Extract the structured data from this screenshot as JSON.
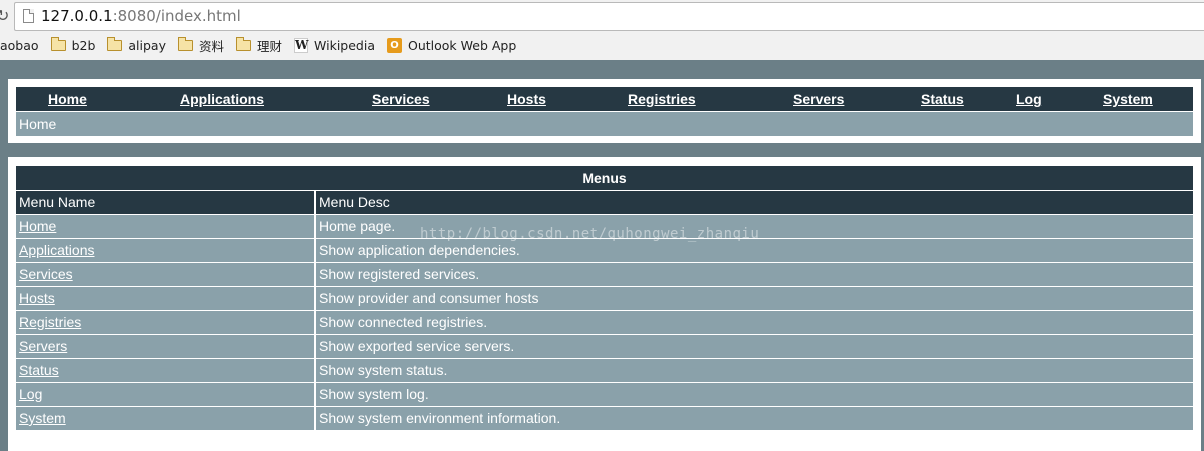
{
  "browser": {
    "url_host": "127.0.0.1",
    "url_rest": ":8080/index.html",
    "bookmarks": [
      {
        "label": "aobao",
        "icon": "none"
      },
      {
        "label": "b2b",
        "icon": "folder-icon"
      },
      {
        "label": "alipay",
        "icon": "folder-icon"
      },
      {
        "label": "资料",
        "icon": "folder-icon"
      },
      {
        "label": "理财",
        "icon": "folder-icon"
      },
      {
        "label": "Wikipedia",
        "icon": "wikipedia-icon"
      },
      {
        "label": "Outlook Web App",
        "icon": "outlook-icon"
      }
    ]
  },
  "nav": {
    "links": [
      "Home",
      "Applications",
      "Services",
      "Hosts",
      "Registries",
      "Servers",
      "Status",
      "Log",
      "System"
    ],
    "breadcrumb": "Home"
  },
  "menus": {
    "title": "Menus",
    "col_name": "Menu Name",
    "col_desc": "Menu Desc",
    "rows": [
      {
        "name": "Home",
        "desc": "Home page."
      },
      {
        "name": "Applications",
        "desc": "Show application dependencies."
      },
      {
        "name": "Services",
        "desc": "Show registered services."
      },
      {
        "name": "Hosts",
        "desc": "Show provider and consumer hosts"
      },
      {
        "name": "Registries",
        "desc": "Show connected registries."
      },
      {
        "name": "Servers",
        "desc": "Show exported service servers."
      },
      {
        "name": "Status",
        "desc": "Show system status."
      },
      {
        "name": "Log",
        "desc": "Show system log."
      },
      {
        "name": "System",
        "desc": "Show system environment information."
      }
    ]
  },
  "watermark": "http://blog.csdn.net/quhongwei_zhanqiu",
  "colors": {
    "dark_bar": "#263843",
    "light_bar": "#8aa1aa",
    "page_bg": "#6b7f87"
  }
}
